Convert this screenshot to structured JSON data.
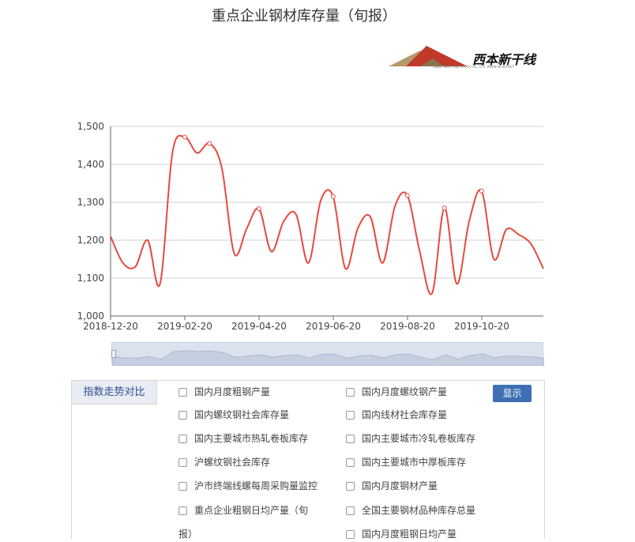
{
  "page_title": "重点企业钢材库存量（旬报）",
  "logo": {
    "name": "西本新干线",
    "subtitle": "XIBEN NEW LINE STOCK CO., LTD.  WWW.96369.NET"
  },
  "chart_data": {
    "type": "line",
    "title": "",
    "xlabel": "",
    "ylabel": "",
    "ylim": [
      1000,
      1500
    ],
    "yticks": [
      1000,
      1100,
      1200,
      1300,
      1400,
      1500
    ],
    "ytick_labels": [
      "1,000",
      "1,100",
      "1,200",
      "1,300",
      "1,400",
      "1,500"
    ],
    "xticks": [
      "2018-12-20",
      "2019-02-20",
      "2019-04-20",
      "2019-06-20",
      "2019-08-20",
      "2019-10-20"
    ],
    "color": "#e64a3e",
    "grid": true,
    "series": [
      {
        "values": [
          1210,
          1140,
          1130,
          1200,
          1085,
          1430,
          1472,
          1430,
          1455,
          1390,
          1165,
          1230,
          1283,
          1170,
          1250,
          1268,
          1140,
          1305,
          1315,
          1125,
          1232,
          1262,
          1140,
          1290,
          1318,
          1170,
          1060,
          1285,
          1085,
          1250,
          1330,
          1150,
          1228,
          1215,
          1190,
          1125
        ]
      }
    ]
  },
  "panel": {
    "tab_label": "指数走势对比",
    "show_button": "显示",
    "options_left": [
      "国内月度粗钢产量",
      "国内螺纹钢社会库存量",
      "国内主要城市热轧卷板库存",
      "沪螺纹钢社会库存",
      "沪市终端线螺每周采购量监控",
      "重点企业粗钢日均产量（旬",
      "报）"
    ],
    "options_right": [
      "国内月度螺纹钢产量",
      "国内线材社会库存量",
      "国内主要城市冷轧卷板库存",
      "国内主要城市中厚板库存",
      "国内月度钢材产量",
      "全国主要钢材品种库存总量",
      "国内月度粗钢日均产量"
    ]
  }
}
